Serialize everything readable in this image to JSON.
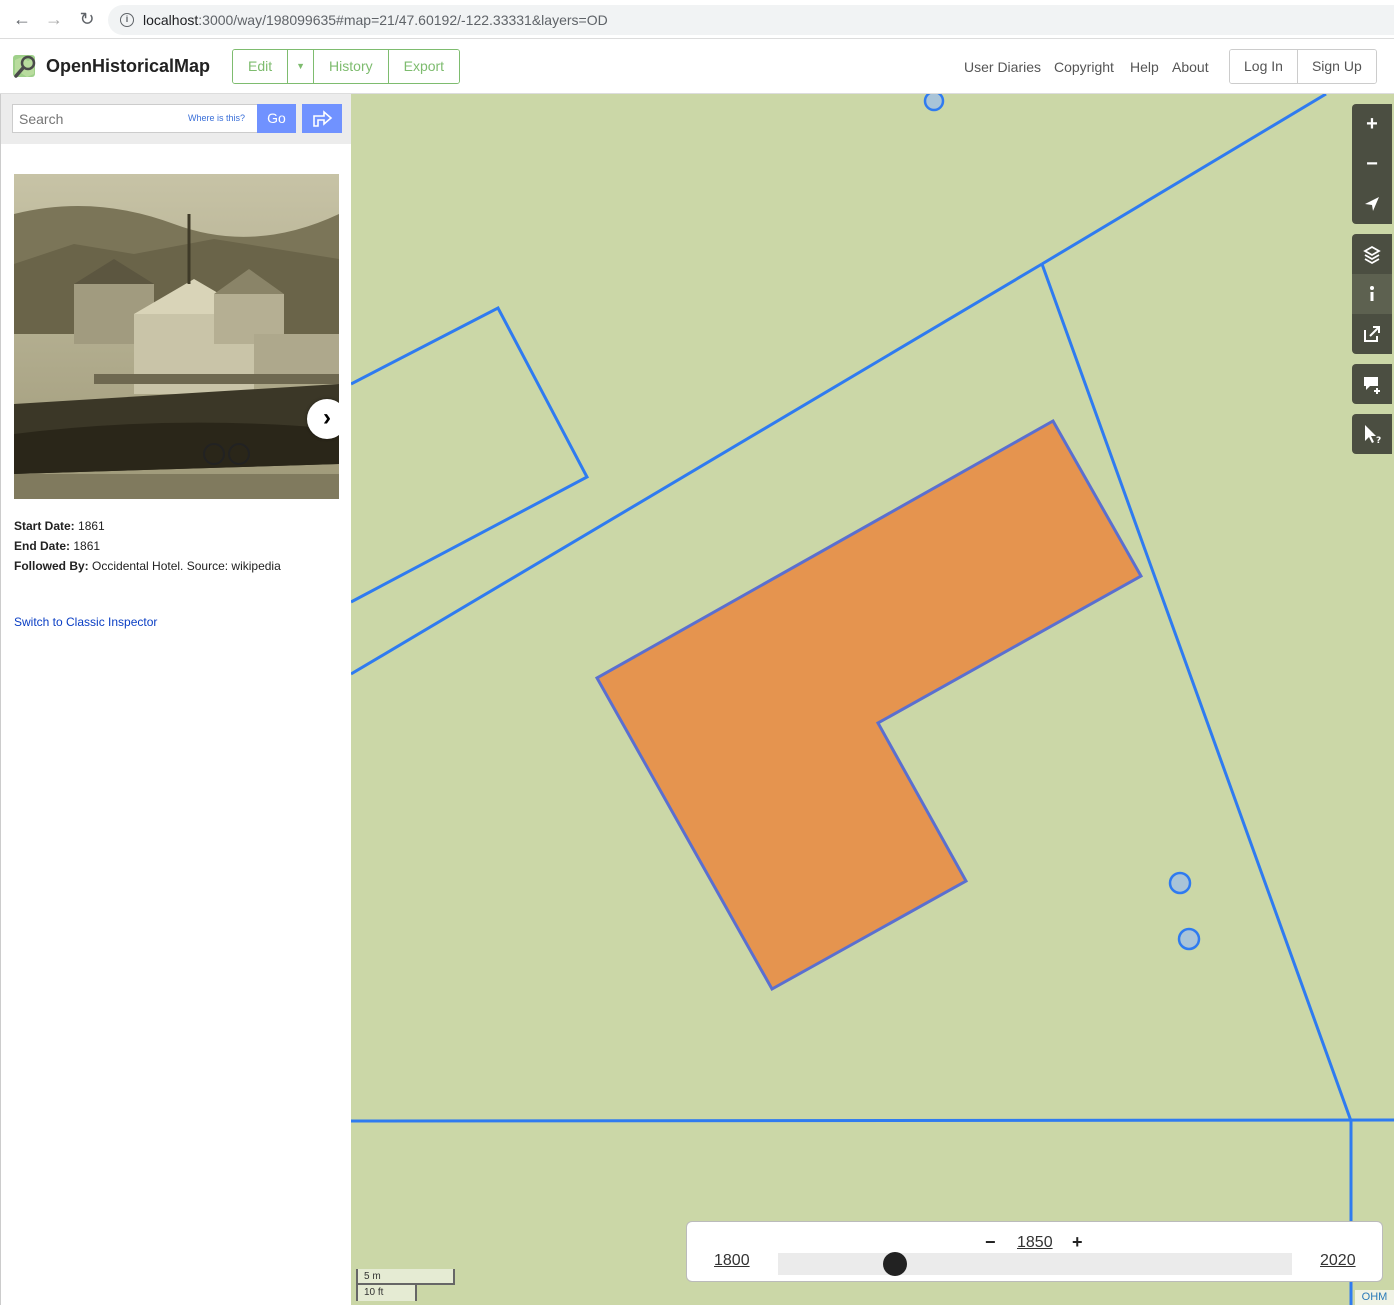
{
  "browser": {
    "url_host": "localhost",
    "url_rest": ":3000/way/198099635#map=21/47.60192/-122.33331&layers=OD",
    "back_icon": "arrow-left-icon",
    "forward_icon": "arrow-right-icon",
    "reload_icon": "reload-icon"
  },
  "header": {
    "brand": "OpenHistoricalMap",
    "edit_label": "Edit",
    "history_label": "History",
    "export_label": "Export",
    "nav": [
      "User Diaries",
      "Copyright",
      "Help",
      "About"
    ],
    "login_label": "Log In",
    "signup_label": "Sign Up",
    "accent_color": "#7ebc6f"
  },
  "sidebar": {
    "search_placeholder": "Search",
    "where_is_this": "Where is this?",
    "go_label": "Go",
    "fields": [
      {
        "label": "Start Date:",
        "value": "1861"
      },
      {
        "label": "End Date:",
        "value": "1861"
      },
      {
        "label": "Followed By:",
        "value": "Occidental Hotel. Source: wikipedia"
      }
    ],
    "classic_link": "Switch to Classic Inspector"
  },
  "map": {
    "background_color": "#cbd7a7",
    "building_fill": "#e5944f",
    "line_color": "#2f7bf0",
    "controls": [
      "zoom-in-icon",
      "zoom-out-icon",
      "locate-icon",
      "layers-icon",
      "info-icon",
      "share-icon",
      "add-note-icon",
      "query-feature-icon"
    ],
    "scale_metric": "5 m",
    "scale_imperial": "10 ft",
    "badge": "OHM"
  },
  "timeslider": {
    "current_year": "1850",
    "min_year": "1800",
    "max_year": "2020",
    "minus": "−",
    "plus": "+",
    "position_fraction": 0.227
  }
}
